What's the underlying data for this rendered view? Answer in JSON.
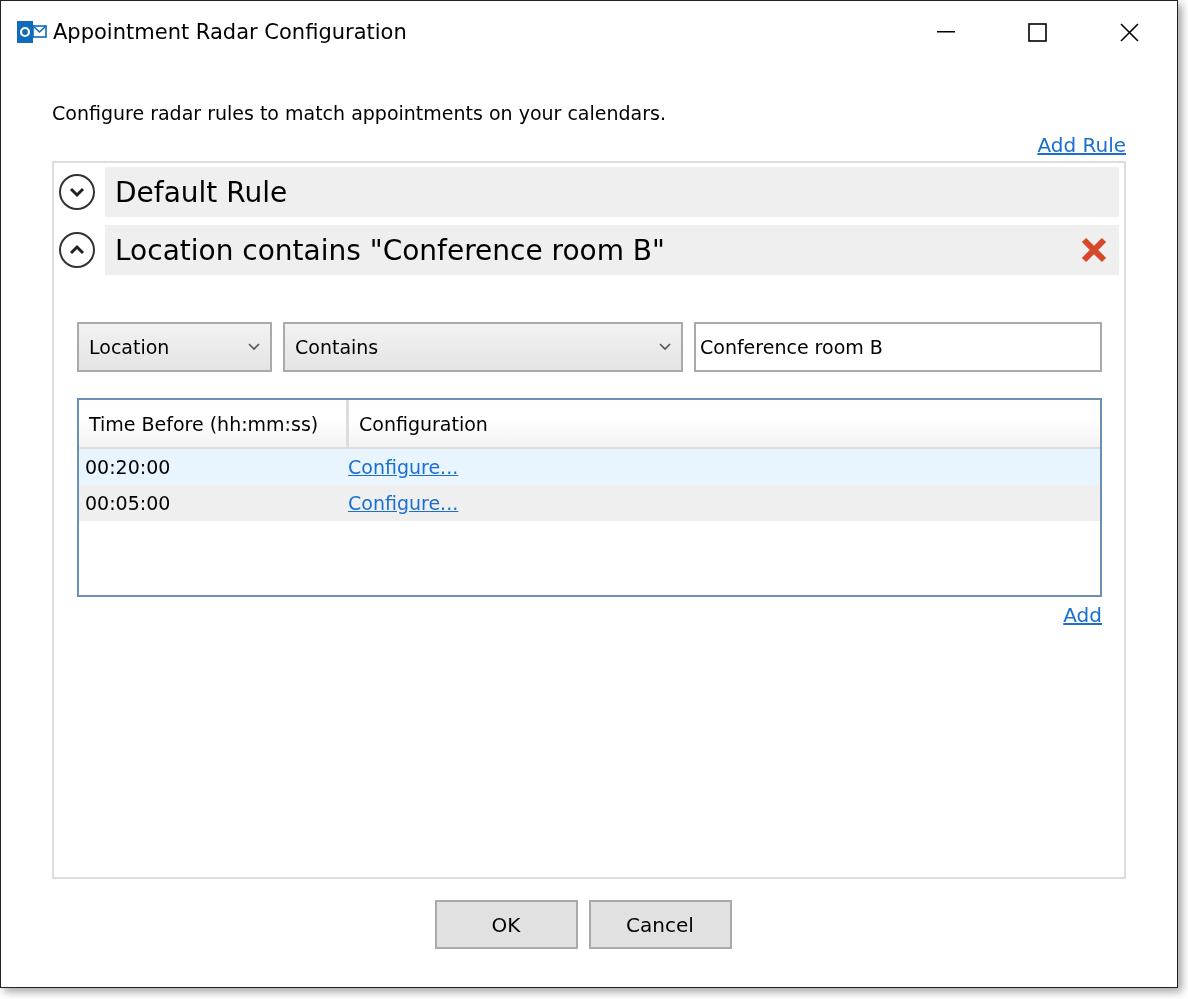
{
  "window": {
    "title": "Appointment Radar Configuration"
  },
  "description": "Configure radar rules to match appointments on your calendars.",
  "add_rule_link": "Add Rule",
  "rules": [
    {
      "title": "Default Rule",
      "expanded": false
    },
    {
      "title": "Location contains \"Conference room B\"",
      "expanded": true,
      "field": "Location",
      "operator": "Contains",
      "value": "Conference room B",
      "table": {
        "columns": [
          "Time Before (hh:mm:ss)",
          "Configuration"
        ],
        "rows": [
          {
            "time": "00:20:00",
            "link": "Configure...",
            "selected": true
          },
          {
            "time": "00:05:00",
            "link": "Configure...",
            "selected": false
          }
        ]
      },
      "add_link": "Add"
    }
  ],
  "buttons": [
    "OK",
    "Cancel"
  ]
}
